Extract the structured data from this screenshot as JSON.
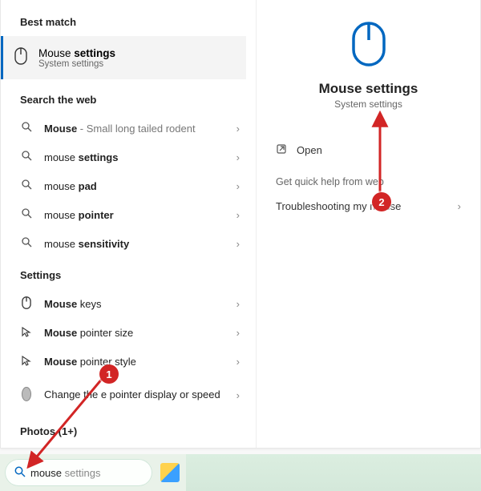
{
  "left": {
    "best_match_header": "Best match",
    "best_match": {
      "title_plain": "Mouse ",
      "title_bold": "settings",
      "subtitle": "System settings"
    },
    "web_header": "Search the web",
    "web_items": [
      {
        "text_bold": "Mouse",
        "hint": " - Small long tailed rodent"
      },
      {
        "prefix": "mouse ",
        "text_bold": "settings"
      },
      {
        "prefix": "mouse ",
        "text_bold": "pad"
      },
      {
        "prefix": "mouse ",
        "text_bold": "pointer"
      },
      {
        "prefix": "mouse ",
        "text_bold": "sensitivity"
      }
    ],
    "settings_header": "Settings",
    "settings_items": [
      {
        "icon": "mouse",
        "label_bold": "Mouse",
        "label_rest": " keys"
      },
      {
        "icon": "pointer",
        "label_bold": "Mouse",
        "label_rest": " pointer size"
      },
      {
        "icon": "pointer",
        "label_bold": "Mouse",
        "label_rest": " pointer style"
      },
      {
        "icon": "mouse-img",
        "label_bold": "",
        "label_rest": "Change the        e pointer display or speed"
      }
    ],
    "photos_header": "Photos (1+)"
  },
  "right": {
    "hero_title": "Mouse settings",
    "hero_sub": "System settings",
    "open_label": "Open",
    "quick_help_label": "Get quick help from web",
    "troubleshoot_label": "Troubleshooting my mouse"
  },
  "taskbar": {
    "query_typed": "mouse",
    "query_ghost": " settings"
  },
  "annotations": {
    "badge1": "1",
    "badge2": "2"
  },
  "colors": {
    "accent": "#0067c0",
    "badge": "#d22525"
  }
}
